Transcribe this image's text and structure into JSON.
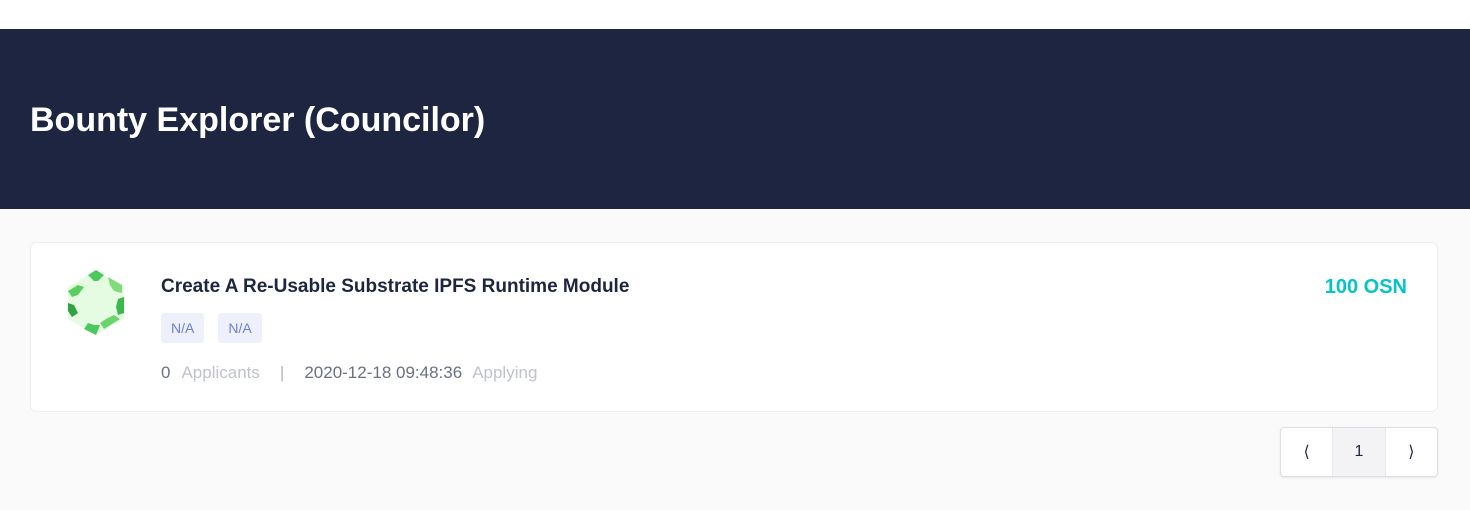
{
  "header": {
    "title": "Bounty Explorer (Councilor)"
  },
  "bounty": {
    "title": "Create A Re-Usable Substrate IPFS Runtime Module",
    "tags": [
      "N/A",
      "N/A"
    ],
    "applicants_count": "0",
    "applicants_label": "Applicants",
    "separator": "|",
    "timestamp": "2020-12-18 09:48:36",
    "status": "Applying",
    "reward": "100 OSN",
    "logo_icon": "hexagon-logo-icon"
  },
  "pagination": {
    "prev": "⟨",
    "current": "1",
    "next": "⟩"
  },
  "colors": {
    "banner": "#1e2540",
    "reward": "#04c4c8",
    "logo_green": "#4cc95c"
  }
}
